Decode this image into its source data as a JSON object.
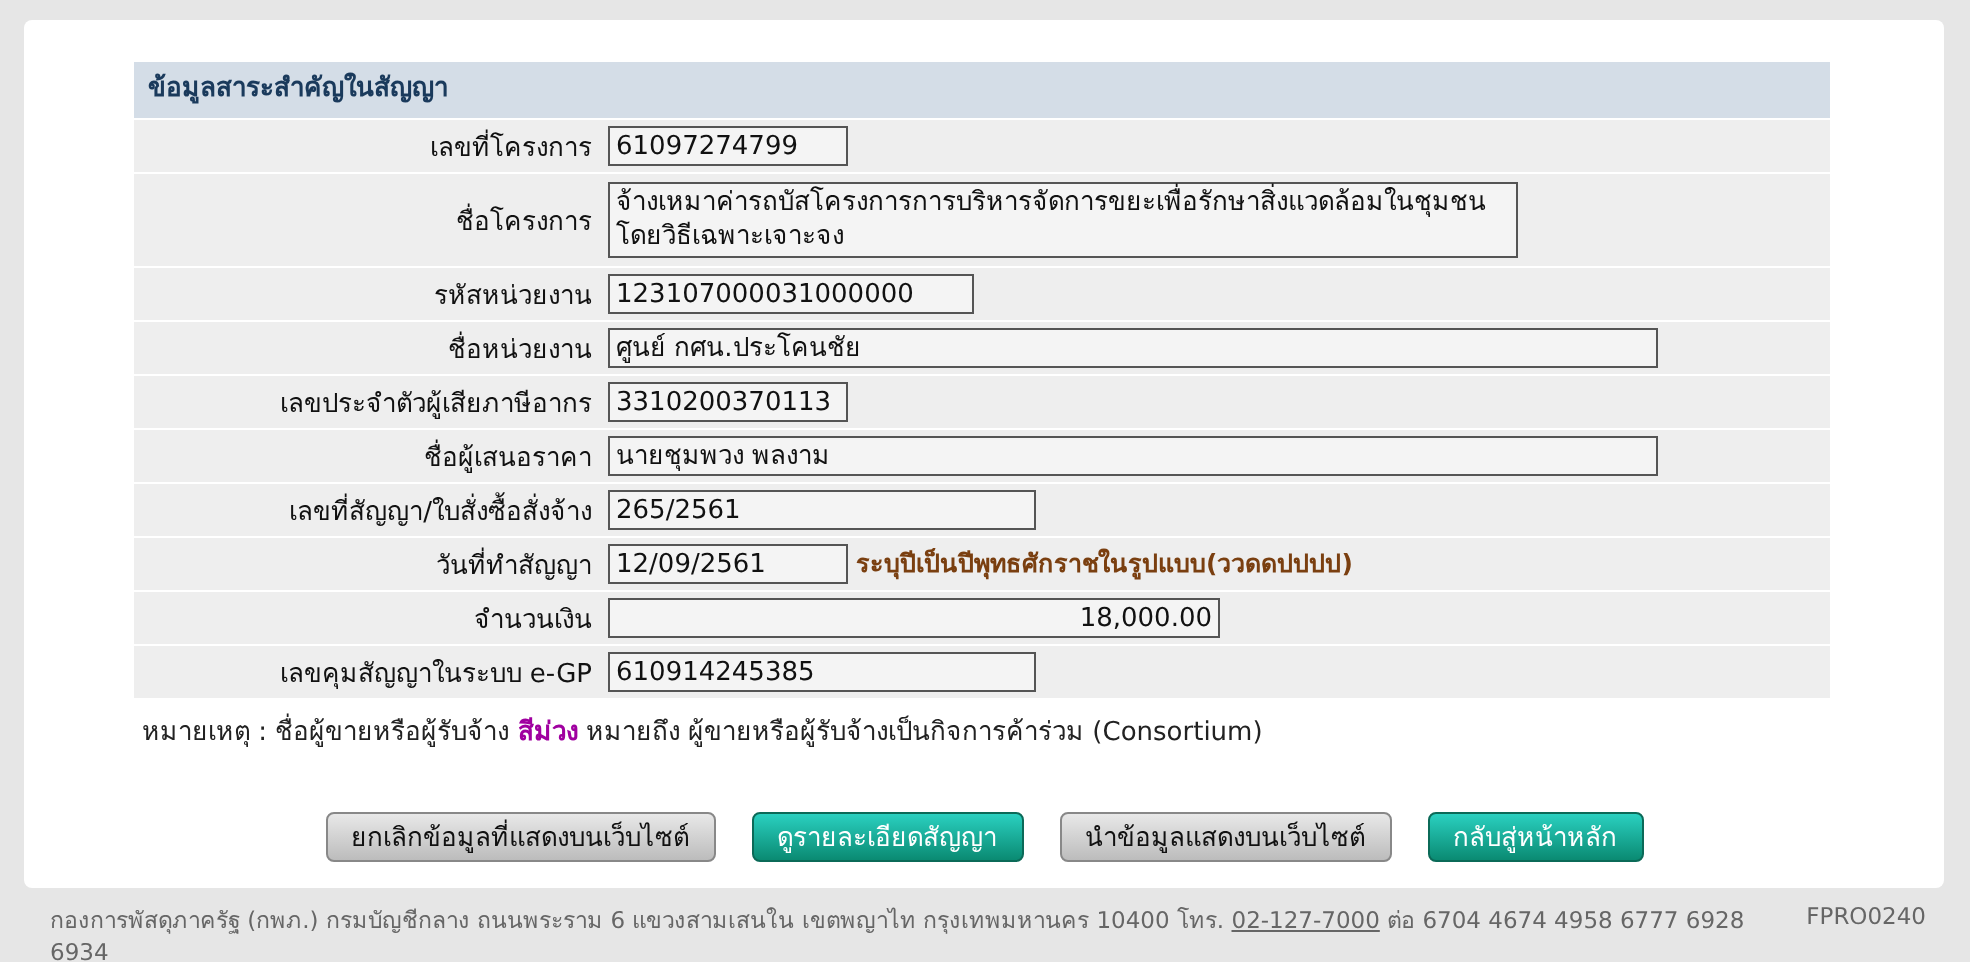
{
  "section": {
    "title": "ข้อมูลสาระสำคัญในสัญญา"
  },
  "rows": [
    {
      "kind": "field",
      "label": "เลขที่โครงการ",
      "value": "61097274799"
    },
    {
      "kind": "multiline",
      "label": "ชื่อโครงการ",
      "lines": [
        "จ้างเหมาค่ารถบัสโครงการการบริหารจัดการขยะเพื่อรักษาสิ่งแวดล้อมในชุมชน",
        "โดยวิธีเฉพาะเจาะจง"
      ]
    },
    {
      "kind": "field",
      "label": "รหัสหน่วยงาน",
      "value": "123107000031000000"
    },
    {
      "kind": "field",
      "label": "ชื่อหน่วยงาน",
      "value": "ศูนย์ กศน.ประโคนชัย"
    },
    {
      "kind": "field",
      "label": "เลขประจำตัวผู้เสียภาษีอากร",
      "value": "3310200370113"
    },
    {
      "kind": "field",
      "label": "ชื่อผู้เสนอราคา",
      "value": "นายชุมพวง  พลงาม"
    },
    {
      "kind": "field",
      "label": "เลขที่สัญญา/ใบสั่งซื้อสั่งจ้าง",
      "value": "265/2561"
    },
    {
      "kind": "date",
      "label": "วันที่ทำสัญญา",
      "value": "12/09/2561",
      "hint": "ระบุปีเป็นปีพุทธศักราชในรูปแบบ(ววดดปปปป)"
    },
    {
      "kind": "amount",
      "label": "จำนวนเงิน",
      "value": "18,000.00"
    },
    {
      "kind": "field",
      "label": "เลขคุมสัญญาในระบบ e-GP",
      "value": "610914245385"
    }
  ],
  "note": "หมายเหตุ : ชื่อผู้ขายหรือผู้รับจ้าง **สีม่วง** หมายถึง ผู้ขายหรือผู้รับจ้างเป็นกิจการค้าร่วม (Consortium)",
  "buttons": [
    {
      "kind": "secondary",
      "label": "ยกเลิกข้อมูลที่แสดงบนเว็บไซต์"
    },
    {
      "kind": "primary",
      "label": "ดูรายละเอียดสัญญา"
    },
    {
      "kind": "secondary",
      "label": "นำข้อมูลแสดงบนเว็บไซต์"
    },
    {
      "kind": "primary",
      "label": "กลับสู่หน้าหลัก"
    }
  ],
  "footer": {
    "address": "กองการพัสดุภาครัฐ (กพภ.) กรมบัญชีกลาง ถนนพระราม 6 แขวงสามเสนใน เขตพญาไท กรุงเทพมหานคร 10400 โทร.",
    "phone": "02-127-7000",
    "extensions": "ต่อ 6704 4674 4958 6777 6928 6934",
    "page_code": "FPRO0240"
  }
}
